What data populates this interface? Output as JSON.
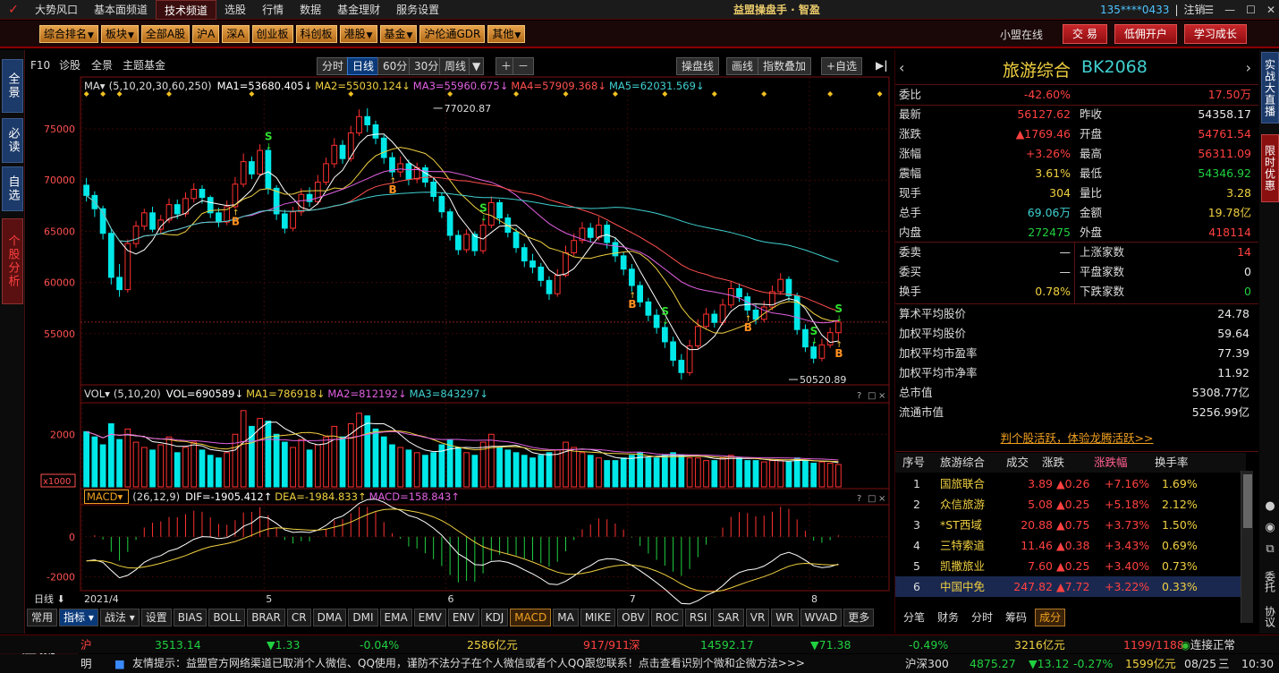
{
  "menubar": {
    "items": [
      "大势风口",
      "基本面频道",
      "技术频道",
      "选股",
      "行情",
      "数据",
      "基金理财",
      "服务设置"
    ],
    "active_index": 2,
    "app_title": "益盟操盘手 · 智盈",
    "user_id": "135****0433",
    "logout": "注销"
  },
  "toolbar2": {
    "buttons": [
      {
        "label": "综合排名",
        "dropdown": true
      },
      {
        "label": "板块",
        "dropdown": true
      },
      {
        "label": "全部A股",
        "dropdown": false
      },
      {
        "label": "沪A",
        "dropdown": false
      },
      {
        "label": "深A",
        "dropdown": false
      },
      {
        "label": "创业板",
        "dropdown": false
      },
      {
        "label": "科创板",
        "dropdown": false
      },
      {
        "label": "港股",
        "dropdown": true
      },
      {
        "label": "基金",
        "dropdown": true
      },
      {
        "label": "沪伦通GDR",
        "dropdown": false
      },
      {
        "label": "其他",
        "dropdown": true
      }
    ],
    "online": "小盟在线",
    "right_buttons": [
      "交 易",
      "低佣开户",
      "学习成长"
    ]
  },
  "left_tabs": [
    "全景",
    "必读",
    "自选",
    "个股分析"
  ],
  "chart_toolbar": {
    "f10": "F10",
    "diagnose": "诊股",
    "panorama": "全景",
    "theme": "主题基金",
    "periods": [
      "分时",
      "日线",
      "60分",
      "30分",
      "周线"
    ],
    "active_period": "日线",
    "right": [
      "操盘线",
      "画线",
      "指数叠加",
      "+自选"
    ]
  },
  "ma_legend": {
    "label": "MA",
    "params": "(5,10,20,30,60,250)",
    "items": [
      {
        "text": "MA1=53680.405↓",
        "color": "#ffffff"
      },
      {
        "text": "MA2=55030.124↓",
        "color": "#f0d040"
      },
      {
        "text": "MA3=55960.675↓",
        "color": "#e060e0"
      },
      {
        "text": "MA4=57909.368↓",
        "color": "#ff5050"
      },
      {
        "text": "MA5=62031.569↓",
        "color": "#40d0d0"
      }
    ]
  },
  "vol_legend": {
    "label": "VOL",
    "params": "(5,10,20)",
    "items": [
      {
        "text": "VOL=690589↓",
        "color": "#ffffff"
      },
      {
        "text": "MA1=786918↓",
        "color": "#f0d040"
      },
      {
        "text": "MA2=812192↓",
        "color": "#e060e0"
      },
      {
        "text": "MA3=843297↓",
        "color": "#40d0d0"
      }
    ]
  },
  "macd_legend": {
    "label": "MACD",
    "params": "(26,12,9)",
    "items": [
      {
        "text": "DIF=-1905.412↑",
        "color": "#ffffff"
      },
      {
        "text": "DEA=-1984.833↑",
        "color": "#f0d040"
      },
      {
        "text": "MACD=158.843↑",
        "color": "#e060e0"
      }
    ]
  },
  "chart_data": {
    "type": "candlestick",
    "price_axis": {
      "ticks": [
        75000,
        70000,
        65000,
        60000,
        55000
      ],
      "range": [
        50000,
        78500
      ]
    },
    "vol_axis": {
      "ticks": [
        2000
      ],
      "unit": "x1000",
      "range": [
        0,
        3200
      ]
    },
    "macd_axis": {
      "ticks": [
        0,
        -2000
      ],
      "range": [
        -2600,
        1600
      ]
    },
    "x_labels": [
      {
        "label": "2021/4",
        "index": 0
      },
      {
        "label": "5",
        "index": 22
      },
      {
        "label": "6",
        "index": 44
      },
      {
        "label": "7",
        "index": 66
      },
      {
        "label": "8",
        "index": 88
      }
    ],
    "x_prefix": "日线",
    "annotations": [
      {
        "text": "77020.87",
        "index": 42
      },
      {
        "text": "50520.89",
        "index": 85
      }
    ],
    "signals": [
      {
        "type": "B",
        "index": 18
      },
      {
        "type": "S",
        "index": 22
      },
      {
        "type": "B",
        "index": 37
      },
      {
        "type": "S",
        "index": 48
      },
      {
        "type": "B",
        "index": 66
      },
      {
        "type": "S",
        "index": 70
      },
      {
        "type": "B",
        "index": 80
      },
      {
        "type": "S",
        "index": 88
      },
      {
        "type": "B",
        "index": 96
      },
      {
        "type": "S",
        "index": 105
      }
    ],
    "candles": [
      [
        69500,
        68500,
        70200,
        67900
      ],
      [
        68500,
        67200,
        68900,
        66400
      ],
      [
        67200,
        64800,
        67500,
        64200
      ],
      [
        64800,
        60500,
        65200,
        59800
      ],
      [
        60500,
        59300,
        61800,
        58600
      ],
      [
        59300,
        63800,
        64200,
        59000
      ],
      [
        63800,
        65500,
        66000,
        63400
      ],
      [
        65500,
        66800,
        67200,
        65100
      ],
      [
        66800,
        65200,
        67400,
        64900
      ],
      [
        65200,
        66100,
        66600,
        64800
      ],
      [
        66100,
        67600,
        68200,
        65800
      ],
      [
        67600,
        66700,
        68100,
        66200
      ],
      [
        66700,
        68200,
        68800,
        66400
      ],
      [
        68200,
        69100,
        69700,
        67800
      ],
      [
        69100,
        68300,
        69500,
        67700
      ],
      [
        68300,
        66800,
        68500,
        66300
      ],
      [
        66800,
        65900,
        67300,
        65400
      ],
      [
        65900,
        67400,
        68000,
        65600
      ],
      [
        67400,
        69600,
        70300,
        67200
      ],
      [
        69600,
        71800,
        72600,
        69300
      ],
      [
        71800,
        70600,
        72300,
        70100
      ],
      [
        70600,
        72900,
        73500,
        70400
      ],
      [
        72900,
        69200,
        73200,
        68600
      ],
      [
        69200,
        66700,
        69500,
        66100
      ],
      [
        66700,
        65300,
        67100,
        64800
      ],
      [
        65300,
        66900,
        67400,
        65000
      ],
      [
        66900,
        68600,
        69200,
        66500
      ],
      [
        68600,
        67900,
        69300,
        67400
      ],
      [
        67900,
        69800,
        70500,
        67600
      ],
      [
        69800,
        71600,
        72200,
        69500
      ],
      [
        71600,
        73400,
        74100,
        71200
      ],
      [
        73400,
        72100,
        73900,
        71600
      ],
      [
        72100,
        74600,
        75300,
        71800
      ],
      [
        74600,
        76200,
        76900,
        74300
      ],
      [
        76200,
        75400,
        77020,
        74700
      ],
      [
        75400,
        74100,
        75800,
        73500
      ],
      [
        74100,
        72200,
        74400,
        71600
      ],
      [
        72200,
        70800,
        72700,
        70300
      ],
      [
        70800,
        71600,
        72300,
        70300
      ],
      [
        71600,
        70100,
        72000,
        69500
      ],
      [
        70100,
        71200,
        71700,
        69700
      ],
      [
        71200,
        69800,
        71500,
        69300
      ],
      [
        69800,
        68400,
        70200,
        67900
      ],
      [
        68400,
        66900,
        68800,
        66300
      ],
      [
        66900,
        64600,
        67200,
        64100
      ],
      [
        64600,
        63200,
        65100,
        62700
      ],
      [
        63200,
        64700,
        65200,
        62900
      ],
      [
        64700,
        63100,
        65000,
        62600
      ],
      [
        63100,
        65600,
        66200,
        62800
      ],
      [
        65600,
        67800,
        68400,
        65300
      ],
      [
        67800,
        66300,
        68100,
        65700
      ],
      [
        66300,
        64900,
        66700,
        64400
      ],
      [
        64900,
        63400,
        65300,
        62900
      ],
      [
        63400,
        62100,
        63800,
        61500
      ],
      [
        62100,
        61500,
        62800,
        60900
      ],
      [
        61500,
        60200,
        61900,
        59600
      ],
      [
        60200,
        58900,
        60600,
        58300
      ],
      [
        58900,
        60700,
        61300,
        58600
      ],
      [
        60700,
        62900,
        63600,
        60500
      ],
      [
        62900,
        64100,
        64800,
        62600
      ],
      [
        64100,
        65300,
        65900,
        63800
      ],
      [
        65300,
        64400,
        65800,
        63900
      ],
      [
        64400,
        65600,
        66400,
        64100
      ],
      [
        65600,
        63900,
        66000,
        63300
      ],
      [
        63900,
        62600,
        64400,
        62000
      ],
      [
        62600,
        61300,
        63000,
        60700
      ],
      [
        61300,
        59700,
        61800,
        59100
      ],
      [
        59700,
        58100,
        60100,
        57600
      ],
      [
        58100,
        56800,
        58500,
        56200
      ],
      [
        56800,
        55600,
        57400,
        55000
      ],
      [
        55600,
        54200,
        56100,
        53600
      ],
      [
        54200,
        52400,
        54700,
        51800
      ],
      [
        52400,
        51200,
        53000,
        50520
      ],
      [
        51200,
        53800,
        54400,
        50900
      ],
      [
        53800,
        55700,
        56400,
        53500
      ],
      [
        55700,
        56900,
        57500,
        55400
      ],
      [
        56900,
        56100,
        57300,
        55600
      ],
      [
        56100,
        57800,
        58400,
        55800
      ],
      [
        57800,
        59400,
        60100,
        57500
      ],
      [
        59400,
        58600,
        59900,
        58100
      ],
      [
        58600,
        57300,
        59000,
        56800
      ],
      [
        57300,
        56400,
        57800,
        55900
      ],
      [
        56400,
        57600,
        58200,
        56100
      ],
      [
        57600,
        59100,
        59700,
        57300
      ],
      [
        59100,
        60300,
        60900,
        58800
      ],
      [
        60300,
        58700,
        60600,
        58200
      ],
      [
        58700,
        55400,
        59000,
        54900
      ],
      [
        55400,
        53700,
        55900,
        53200
      ],
      [
        53700,
        52600,
        54200,
        52100
      ],
      [
        52600,
        53900,
        54500,
        52300
      ],
      [
        53900,
        55100,
        55600,
        53600
      ],
      [
        55100,
        56127,
        56400,
        54300
      ]
    ],
    "ma_series": [
      {
        "name": "MA1",
        "color": "#ffffff",
        "last": 53680.405
      },
      {
        "name": "MA2",
        "color": "#f0d040",
        "last": 55030.124
      },
      {
        "name": "MA3",
        "color": "#e060e0",
        "last": 55960.675
      },
      {
        "name": "MA4",
        "color": "#ff5050",
        "last": 57909.368
      },
      {
        "name": "MA5",
        "color": "#40d0d0",
        "last": 62031.569
      }
    ],
    "volumes": [
      2100,
      1900,
      1600,
      2400,
      1800,
      2200,
      1700,
      1500,
      1400,
      1600,
      1900,
      1300,
      1500,
      1700,
      1400,
      1200,
      1100,
      1300,
      2000,
      2900,
      2300,
      2600,
      2500,
      2000,
      1700,
      1500,
      1800,
      1400,
      1600,
      1900,
      2300,
      1900,
      2400,
      2800,
      2700,
      2200,
      1900,
      1600,
      1500,
      1400,
      1300,
      1200,
      1300,
      1600,
      1800,
      1500,
      1300,
      1200,
      1700,
      2000,
      1500,
      1400,
      1300,
      1200,
      1100,
      1200,
      1300,
      1400,
      1700,
      1500,
      1300,
      1200,
      1100,
      1000,
      1000,
      1100,
      1200,
      1300,
      1100,
      1100,
      1200,
      1300,
      1200,
      1100,
      1100,
      1000,
      1000,
      1100,
      1200,
      1100,
      1000,
      1000,
      950,
      1000,
      1000,
      950,
      1100,
      1000,
      900,
      950,
      900,
      850,
      800,
      760,
      690
    ],
    "macd": {
      "dif_start": -1200,
      "bars_note": "derived from candles"
    }
  },
  "indicator_bar": {
    "tabs": [
      "常用",
      "指标",
      "战法",
      "设置",
      "BIAS",
      "BOLL",
      "BRAR",
      "CR",
      "DMA",
      "DMI",
      "EMA",
      "EMV",
      "ENV",
      "KDJ",
      "MACD",
      "MA",
      "MIKE",
      "OBV",
      "ROC",
      "RSI",
      "SAR",
      "VR",
      "WR",
      "WVAD",
      "更多"
    ],
    "active": "MACD",
    "selected": "指标"
  },
  "quote": {
    "title": "旅游综合",
    "code": "BK2068",
    "weibi_label": "委比",
    "weibi": "-42.60%",
    "weibi_vol": "17.50万",
    "rows": [
      {
        "l1": "最新",
        "v1": "56127.62",
        "c1": "red",
        "l2": "昨收",
        "v2": "54358.17",
        "c2": "white"
      },
      {
        "l1": "涨跌",
        "v1": "▲1769.46",
        "c1": "red",
        "l2": "开盘",
        "v2": "54761.54",
        "c2": "red"
      },
      {
        "l1": "涨幅",
        "v1": "+3.26%",
        "c1": "red",
        "l2": "最高",
        "v2": "56311.09",
        "c2": "red"
      },
      {
        "l1": "震幅",
        "v1": "3.61%",
        "c1": "yellow",
        "l2": "最低",
        "v2": "54346.92",
        "c2": "green"
      },
      {
        "l1": "现手",
        "v1": "304",
        "c1": "yellow",
        "l2": "量比",
        "v2": "3.28",
        "c2": "yellow"
      },
      {
        "l1": "总手",
        "v1": "69.06万",
        "c1": "cyan",
        "l2": "金额",
        "v2": "19.78亿",
        "c2": "yellow"
      },
      {
        "l1": "内盘",
        "v1": "272475",
        "c1": "green",
        "l2": "外盘",
        "v2": "418114",
        "c2": "red"
      }
    ],
    "rows2": [
      {
        "l1": "委卖",
        "v1": "—",
        "c1": "white",
        "l2": "上涨家数",
        "v2": "14",
        "c2": "red"
      },
      {
        "l1": "委买",
        "v1": "—",
        "c1": "white",
        "l2": "平盘家数",
        "v2": "0",
        "c2": "white"
      },
      {
        "l1": "换手",
        "v1": "0.78%",
        "c1": "yellow",
        "l2": "下跌家数",
        "v2": "0",
        "c2": "green"
      }
    ],
    "stats": [
      {
        "l": "算术平均股价",
        "v": "24.78"
      },
      {
        "l": "加权平均股价",
        "v": "59.64"
      },
      {
        "l": "加权平均市盈率",
        "v": "77.39"
      },
      {
        "l": "加权平均市净率",
        "v": "11.92"
      },
      {
        "l": "总市值",
        "v": "5308.77亿"
      },
      {
        "l": "流通市值",
        "v": "5256.99亿"
      }
    ],
    "promo": "判个股活跃，体验龙腾活跃>>"
  },
  "components": {
    "headers": [
      "序号",
      "旅游综合",
      "成交",
      "涨跌",
      "涨跌幅",
      "换手率"
    ],
    "rows": [
      {
        "no": "1",
        "name": "国旅联合",
        "price": "3.89",
        "chg": "▲0.26",
        "pct": "+7.16%",
        "turn": "1.69%"
      },
      {
        "no": "2",
        "name": "众信旅游",
        "price": "5.08",
        "chg": "▲0.25",
        "pct": "+5.18%",
        "turn": "2.12%"
      },
      {
        "no": "3",
        "name": "*ST西域",
        "price": "20.88",
        "chg": "▲0.75",
        "pct": "+3.73%",
        "turn": "1.50%"
      },
      {
        "no": "4",
        "name": "三特索道",
        "price": "11.46",
        "chg": "▲0.38",
        "pct": "+3.43%",
        "turn": "0.69%"
      },
      {
        "no": "5",
        "name": "凯撒旅业",
        "price": "7.60",
        "chg": "▲0.25",
        "pct": "+3.40%",
        "turn": "0.73%"
      },
      {
        "no": "6",
        "name": "中国中免",
        "price": "247.82",
        "chg": "▲7.72",
        "pct": "+3.22%",
        "turn": "0.33%"
      }
    ],
    "selected_index": 5
  },
  "rp_tabs": [
    "分笔",
    "财务",
    "分时",
    "筹码",
    "成分"
  ],
  "rp_tab_active": "成分",
  "far_right": [
    "实战大直播",
    "限时优惠"
  ],
  "far_right_bottom": [
    "委托",
    "协议"
  ],
  "status": {
    "sh_label": "沪",
    "sh_index": "3513.14",
    "sh_chg": "▼1.33",
    "sh_pct": "-0.04%",
    "sh_amt": "2586亿元",
    "sh_updown": "917/911",
    "sz_label": "深",
    "sz_index": "14592.17",
    "sz_chg": "▼71.38",
    "sz_pct": "-0.49%",
    "sz_amt": "3216亿元",
    "sz_updown": "1199/1188",
    "conn": "连接正常",
    "brand": "智盈",
    "tip_prefix": "明",
    "tip": "友情提示：益盟官方网络渠道已取消个人微信、QQ使用，谨防不法分子在个人微信或者个人QQ跟您联系！点击查看识别个微和企微方法>>>",
    "hs300_label": "沪深300",
    "hs300": "4875.27",
    "hs300_chg": "▼13.12",
    "hs300_pct": "-0.27%",
    "hs300_amt": "1599亿元",
    "date": "08/25",
    "weekday": "三",
    "time": "10:30"
  }
}
